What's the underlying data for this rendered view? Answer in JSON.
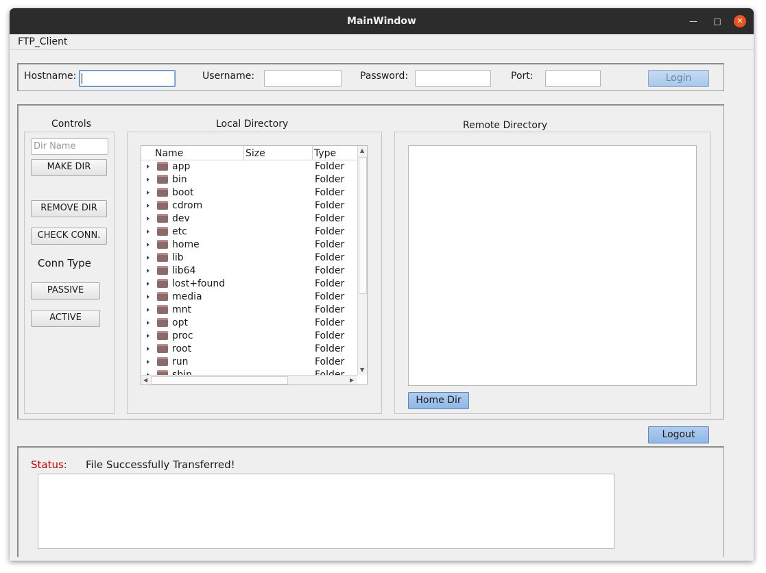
{
  "window": {
    "title": "MainWindow"
  },
  "menu": {
    "items": [
      "FTP_Client"
    ]
  },
  "login_bar": {
    "hostname_label": "Hostname:",
    "hostname_value": "",
    "username_label": "Username:",
    "username_value": "",
    "password_label": "Password:",
    "password_value": "",
    "port_label": "Port:",
    "port_value": "",
    "login_label": "Login"
  },
  "controls": {
    "title": "Controls",
    "dir_name_placeholder": "Dir Name",
    "make_dir": "MAKE DIR",
    "remove_dir": "REMOVE DIR",
    "check_conn": "CHECK CONN.",
    "conn_type": "Conn Type",
    "passive": "PASSIVE",
    "active": "ACTIVE"
  },
  "local": {
    "title": "Local Directory",
    "columns": [
      "Name",
      "Size",
      "Type"
    ],
    "rows": [
      {
        "name": "app",
        "size": "",
        "type": "Folder"
      },
      {
        "name": "bin",
        "size": "",
        "type": "Folder"
      },
      {
        "name": "boot",
        "size": "",
        "type": "Folder"
      },
      {
        "name": "cdrom",
        "size": "",
        "type": "Folder"
      },
      {
        "name": "dev",
        "size": "",
        "type": "Folder"
      },
      {
        "name": "etc",
        "size": "",
        "type": "Folder"
      },
      {
        "name": "home",
        "size": "",
        "type": "Folder"
      },
      {
        "name": "lib",
        "size": "",
        "type": "Folder"
      },
      {
        "name": "lib64",
        "size": "",
        "type": "Folder"
      },
      {
        "name": "lost+found",
        "size": "",
        "type": "Folder"
      },
      {
        "name": "media",
        "size": "",
        "type": "Folder"
      },
      {
        "name": "mnt",
        "size": "",
        "type": "Folder"
      },
      {
        "name": "opt",
        "size": "",
        "type": "Folder"
      },
      {
        "name": "proc",
        "size": "",
        "type": "Folder"
      },
      {
        "name": "root",
        "size": "",
        "type": "Folder"
      },
      {
        "name": "run",
        "size": "",
        "type": "Folder"
      },
      {
        "name": "sbin",
        "size": "",
        "type": "Folder"
      }
    ]
  },
  "remote": {
    "title": "Remote Directory",
    "home_dir": "Home Dir"
  },
  "logout_label": "Logout",
  "status": {
    "label": "Status:",
    "message": "File Successfully Transferred!",
    "label_color": "#c00000"
  },
  "icons": [
    "minimize-icon",
    "maximize-icon",
    "close-icon",
    "expand-arrow-icon",
    "folder-icon"
  ]
}
